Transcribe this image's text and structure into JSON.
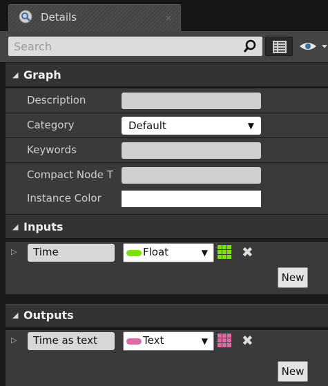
{
  "tab": {
    "title": "Details",
    "close": "×"
  },
  "search": {
    "placeholder": "Search"
  },
  "sections": {
    "graph": {
      "title": "Graph",
      "rows": {
        "description": {
          "label": "Description",
          "value": ""
        },
        "category": {
          "label": "Category",
          "value": "Default"
        },
        "keywords": {
          "label": "Keywords",
          "value": ""
        },
        "compact_node": {
          "label": "Compact Node T",
          "value": ""
        },
        "instance_color": {
          "label": "Instance Color",
          "color": "#ffffff"
        }
      }
    },
    "inputs": {
      "title": "Inputs",
      "pin": {
        "name": "Time",
        "type": "Float",
        "type_color": "#7ce00f",
        "grid_color": "#7ce00f"
      },
      "new_label": "New"
    },
    "outputs": {
      "title": "Outputs",
      "pin": {
        "name": "Time as text",
        "type": "Text",
        "type_color": "#e06aa6",
        "grid_color": "#e06aa6"
      },
      "new_label": "New"
    }
  }
}
